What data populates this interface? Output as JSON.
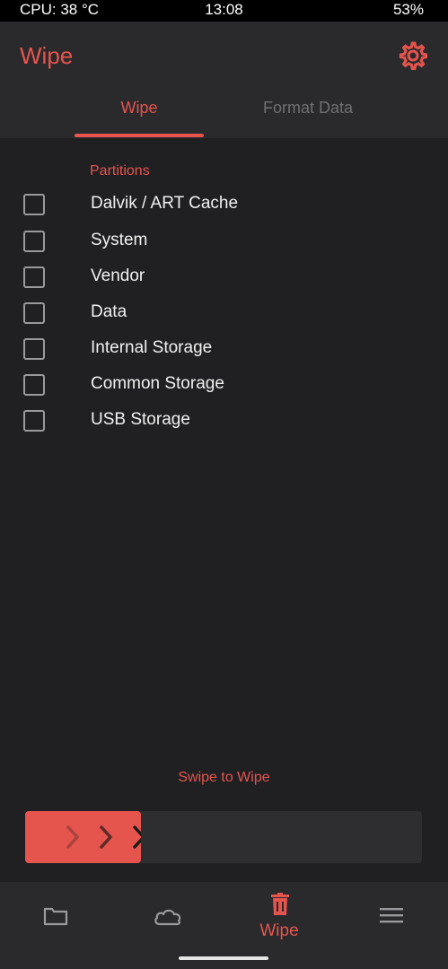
{
  "status_bar": {
    "cpu": "CPU: 38 °C",
    "time": "13:08",
    "battery": "53%"
  },
  "header": {
    "title": "Wipe",
    "settings_icon": "gear-icon"
  },
  "tabs": [
    {
      "label": "Wipe",
      "active": true
    },
    {
      "label": "Format Data",
      "active": false
    }
  ],
  "partitions": {
    "section_title": "Partitions",
    "items": [
      {
        "label": "Dalvik / ART Cache",
        "checked": false
      },
      {
        "label": "System",
        "checked": false
      },
      {
        "label": "Vendor",
        "checked": false
      },
      {
        "label": "Data",
        "checked": false
      },
      {
        "label": "Internal Storage",
        "checked": false
      },
      {
        "label": "Common Storage",
        "checked": false
      },
      {
        "label": "USB Storage",
        "checked": false
      }
    ]
  },
  "swipe": {
    "label": "Swipe to Wipe",
    "handle_icon": "triple-chevron-right-icon"
  },
  "bottom_nav": {
    "items": [
      {
        "icon": "folder-icon",
        "label": "",
        "active": false
      },
      {
        "icon": "cloud-icon",
        "label": "",
        "active": false
      },
      {
        "icon": "trash-icon",
        "label": "Wipe",
        "active": true
      },
      {
        "icon": "menu-icon",
        "label": "",
        "active": false
      }
    ]
  },
  "colors": {
    "accent": "#e5544d",
    "background": "#202023",
    "surface": "#2a2a2d",
    "inactive": "#707073"
  }
}
